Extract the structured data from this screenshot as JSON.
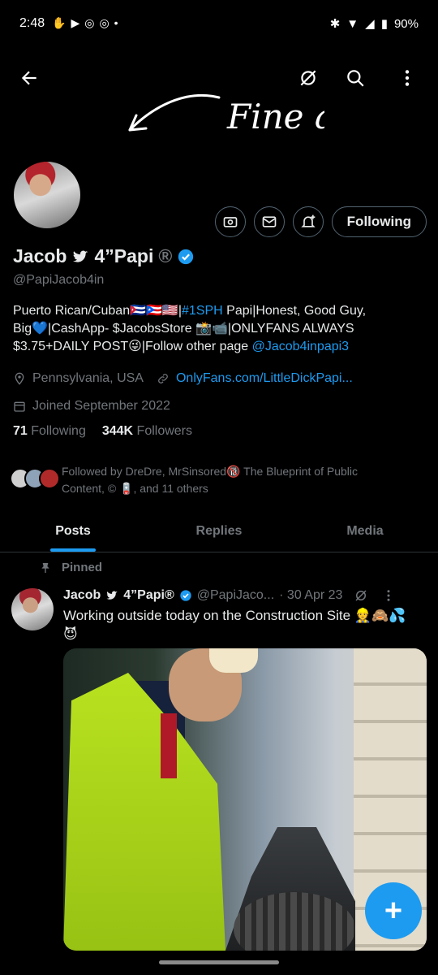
{
  "status_bar": {
    "time": "2:48",
    "battery": "90%"
  },
  "annotation": {
    "handwritten_text": "Fine asf"
  },
  "profile": {
    "display_name_part1": "Jacob",
    "display_name_part2": "4”Papi",
    "registered_mark": "®",
    "handle": "@PapiJacob4in",
    "bio": {
      "line1_prefix": "Puerto Rican/Cuban🇨🇺🇵🇷🇺🇸|",
      "hashtag": "#1SPH",
      "line1_suffix": " Papi|Honest, Good Guy,",
      "line2": "Big💙|CashApp- $JacobsStore 📸📹|ONLYFANS ALWAYS",
      "line3_prefix": "$3.75+DAILY POST😜|Follow other page ",
      "mention": "@Jacob4inpapi3"
    },
    "location": "Pennsylvania, USA",
    "website": "OnlyFans.com/LittleDickPapi...",
    "joined": "Joined September 2022",
    "following_count": "71",
    "following_label": "Following",
    "followers_count": "344K",
    "followers_label": "Followers",
    "followed_by_line1": "Followed by DreDre, MrSinsored🔞 The Blueprint of Public",
    "followed_by_line2": "Content, © 🪫, and 11 others",
    "following_button": "Following"
  },
  "tabs": [
    {
      "label": "Posts",
      "active": true
    },
    {
      "label": "Replies",
      "active": false
    },
    {
      "label": "Media",
      "active": false
    }
  ],
  "pinned_post": {
    "pinned_label": "Pinned",
    "author_part1": "Jacob",
    "author_part2": "4”Papi®",
    "handle": "@PapiJaco...",
    "date": "· 30 Apr 23",
    "text_line1": "Working outside today on the Construction Site 👷🙈💦",
    "text_line2": "😈"
  },
  "fab_label": "+",
  "colors": {
    "accent": "#1d9bf0",
    "background": "#000000",
    "secondary_text": "#71767b"
  }
}
